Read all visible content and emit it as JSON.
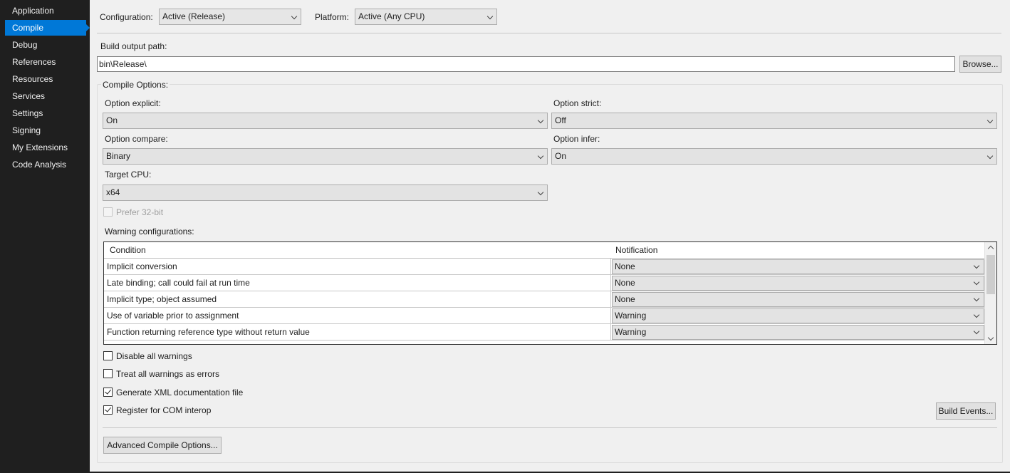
{
  "sidebar": {
    "items": [
      {
        "label": "Application"
      },
      {
        "label": "Compile"
      },
      {
        "label": "Debug"
      },
      {
        "label": "References"
      },
      {
        "label": "Resources"
      },
      {
        "label": "Services"
      },
      {
        "label": "Settings"
      },
      {
        "label": "Signing"
      },
      {
        "label": "My Extensions"
      },
      {
        "label": "Code Analysis"
      }
    ],
    "active": "Compile"
  },
  "header": {
    "configuration_label": "Configuration:",
    "configuration_value": "Active (Release)",
    "platform_label": "Platform:",
    "platform_value": "Active (Any CPU)"
  },
  "build_output": {
    "label": "Build output path:",
    "value": "bin\\Release\\",
    "browse_label": "Browse..."
  },
  "compile_options": {
    "group_label": "Compile Options:",
    "option_explicit_label": "Option explicit:",
    "option_explicit_value": "On",
    "option_strict_label": "Option strict:",
    "option_strict_value": "Off",
    "option_compare_label": "Option compare:",
    "option_compare_value": "Binary",
    "option_infer_label": "Option infer:",
    "option_infer_value": "On",
    "target_cpu_label": "Target CPU:",
    "target_cpu_value": "x64",
    "prefer32_label": "Prefer 32-bit",
    "warning_config_label": "Warning configurations:"
  },
  "warnings_table": {
    "headers": [
      "Condition",
      "Notification"
    ],
    "rows": [
      {
        "condition": "Implicit conversion",
        "notification": "None"
      },
      {
        "condition": "Late binding; call could fail at run time",
        "notification": "None"
      },
      {
        "condition": "Implicit type; object assumed",
        "notification": "None"
      },
      {
        "condition": "Use of variable prior to assignment",
        "notification": "Warning"
      },
      {
        "condition": "Function returning reference type without return value",
        "notification": "Warning"
      }
    ]
  },
  "checkboxes": {
    "disable_all_warnings": {
      "label": "Disable all warnings",
      "checked": false
    },
    "treat_warnings_errors": {
      "label": "Treat all warnings as errors",
      "checked": false
    },
    "generate_xml": {
      "label": "Generate XML documentation file",
      "checked": true
    },
    "register_com": {
      "label": "Register for COM interop",
      "checked": true
    }
  },
  "buttons": {
    "build_events": "Build Events...",
    "advanced_compile": "Advanced Compile Options..."
  }
}
